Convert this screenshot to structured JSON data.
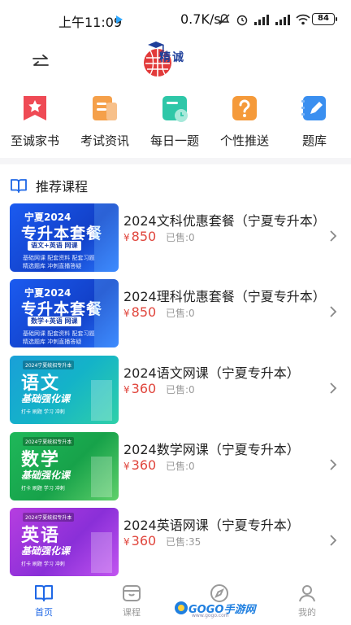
{
  "status_bar": {
    "time": "上午11:09",
    "speed": "0.7K/s",
    "battery": "84"
  },
  "header": {
    "logo_text": "精诚"
  },
  "quick_nav": [
    {
      "label": "至诚家书",
      "icon": "star-badge-icon",
      "color": "#ef4a55"
    },
    {
      "label": "考试资讯",
      "icon": "news-icon",
      "color": "#f5a04a"
    },
    {
      "label": "每日一题",
      "icon": "calendar-clock-icon",
      "color": "#2ec7a8"
    },
    {
      "label": "个性推送",
      "icon": "question-icon",
      "color": "#f59a3a"
    },
    {
      "label": "题库",
      "icon": "edit-notebook-icon",
      "color": "#3a8ff0"
    }
  ],
  "section": {
    "title": "推荐课程"
  },
  "courses": [
    {
      "title": "2024文科优惠套餐（宁夏专升本）",
      "currency": "¥",
      "price": "850",
      "sold": "已售:0",
      "thumb": {
        "top": "宁夏2024",
        "big": "专升本套餐",
        "tag": "语文+英语 网课",
        "line1": "基础网课  配套资料  配套习题",
        "line2": "精选题库  冲刺直播答疑"
      }
    },
    {
      "title": "2024理科优惠套餐（宁夏专升本）",
      "currency": "¥",
      "price": "850",
      "sold": "已售:0",
      "thumb": {
        "top": "宁夏2024",
        "big": "专升本套餐",
        "tag": "数学+英语 网课",
        "line1": "基础网课  配套资料  配套习题",
        "line2": "精选题库  冲刺直播答疑"
      }
    },
    {
      "title": "2024语文网课（宁夏专升本）",
      "currency": "¥",
      "price": "360",
      "sold": "已售:0",
      "thumb": {
        "small": "2024宁夏统招专升本",
        "subject": "语文",
        "sub": "基础强化课",
        "pills": "打卡  刷题  学习  冲刺"
      }
    },
    {
      "title": "2024数学网课（宁夏专升本）",
      "currency": "¥",
      "price": "360",
      "sold": "已售:0",
      "thumb": {
        "small": "2024宁夏统招专升本",
        "subject": "数学",
        "sub": "基础强化课",
        "pills": "打卡  刷题  学习  冲刺"
      }
    },
    {
      "title": "2024英语网课（宁夏专升本）",
      "currency": "¥",
      "price": "360",
      "sold": "已售:35",
      "thumb": {
        "small": "2024宁夏统招专升本",
        "subject": "英语",
        "sub": "基础强化课",
        "pills": "打卡  刷题  学习  冲刺"
      }
    }
  ],
  "tabs": [
    {
      "label": "首页",
      "icon": "book-open-icon",
      "active": true
    },
    {
      "label": "课程",
      "icon": "course-box-icon",
      "active": false
    },
    {
      "label": "",
      "icon": "compass-icon",
      "active": false
    },
    {
      "label": "我的",
      "icon": "person-icon",
      "active": false
    }
  ],
  "watermark": {
    "text": "GOGO手游网",
    "sub": "www.gogo.com"
  },
  "colors": {
    "accent": "#1e67e6",
    "price": "#e0453c",
    "muted": "#9a9a9a"
  }
}
